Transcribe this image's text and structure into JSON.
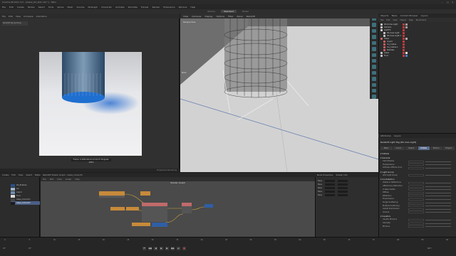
{
  "window": {
    "title": "Cinema 4D R21.117 - [Glass_Tut_R21.c4d *] - Main"
  },
  "menubar": [
    "File",
    "Edit",
    "Create",
    "Modes",
    "Select",
    "Tools",
    "Spline",
    "Mesh",
    "Volume",
    "MoGraph",
    "Character",
    "Animate",
    "Simulate",
    "Tracker",
    "Render",
    "Extensions",
    "Window",
    "Help"
  ],
  "layout_tabs": [
    {
      "label": "Startup",
      "active": false
    },
    {
      "label": "Standard",
      "active": true
    },
    {
      "label": "Model",
      "active": false
    }
  ],
  "render_viewer": {
    "menu": [
      "File",
      "Edit",
      "View",
      "Compare",
      "Animation"
    ],
    "side_label": "Redshift RenderView",
    "caption": "Frame: 0   2020-09-14 12:53:27 Progress: 100%",
    "status": "Progressive Rendering"
  },
  "viewport": {
    "menu": [
      "View",
      "Cameras",
      "Display",
      "Options",
      "Filter",
      "Panel",
      "Redshift"
    ],
    "label": "Perspective",
    "left_label": "Mesh"
  },
  "right_toolbar_count": 14,
  "objects": {
    "tabs": [
      "Objects",
      "Takes",
      "Content Browser",
      "Layers"
    ],
    "menu": [
      "File",
      "Edit",
      "View",
      "Object",
      "Tags",
      "Bookmarks"
    ],
    "rows": [
      {
        "name": "RS Dome Light",
        "color": "#c9c9c9",
        "indent": 0,
        "tags": [
          "#c03a3a",
          "#9a9a9a"
        ]
      },
      {
        "name": "Camera",
        "color": "#c9c9c9",
        "indent": 0,
        "tags": [
          "#c03a3a",
          "#9a9a9a"
        ]
      },
      {
        "name": "LIGHTS",
        "color": "#d0d0d0",
        "indent": 0,
        "tags": [
          "#c03a3a"
        ]
      },
      {
        "name": "RS Area Light",
        "color": "#c9c9c9",
        "indent": 1,
        "tags": [
          "#c03a3a"
        ]
      },
      {
        "name": "RS Area Light.1",
        "color": "#c9c9c9",
        "indent": 1,
        "tags": [
          "#c03a3a"
        ]
      },
      {
        "name": "Glass",
        "color": "#d06060",
        "indent": 0,
        "tags": [
          "#c03a3a",
          "#aaaaaa"
        ]
      },
      {
        "name": "Liquid",
        "color": "#d06060",
        "indent": 1,
        "tags": [
          "#c03a3a"
        ]
      },
      {
        "name": "Ice_Cubes",
        "color": "#d06060",
        "indent": 1,
        "tags": [
          "#c03a3a"
        ]
      },
      {
        "name": "Ice_Cubes.1",
        "color": "#d06060",
        "indent": 1,
        "tags": [
          "#c03a3a"
        ]
      },
      {
        "name": "Bubbles",
        "color": "#d06060",
        "indent": 1,
        "tags": [
          "#c03a3a"
        ]
      },
      {
        "name": "Glass",
        "color": "#c9c9c9",
        "indent": 0,
        "tags": [
          "#c03a3a",
          "#dddddd"
        ]
      },
      {
        "name": "Floor",
        "color": "#c9c9c9",
        "indent": 0,
        "tags": [
          "#c03a3a",
          "#3f7fd0"
        ]
      }
    ]
  },
  "attributes": {
    "tabs": [
      "Attributes",
      "Layers"
    ],
    "header": "Redshift Light Tag [RS Area Light]",
    "subtabs": [
      {
        "label": "Basic",
        "on": false
      },
      {
        "label": "Coord.",
        "on": false
      },
      {
        "label": "Object",
        "on": false
      },
      {
        "label": "Details",
        "on": true
      },
      {
        "label": "Photon",
        "on": false
      },
      {
        "label": "Project",
        "on": false
      }
    ],
    "sections": [
      {
        "title": "Details",
        "params": []
      },
      {
        "title": "General",
        "params": [
          "Cast Shadow",
          "Transparency",
          "Softness Affects Color"
        ]
      },
      {
        "title": "Light Group",
        "params": [
          "AOV Light Group"
        ]
      },
      {
        "title": "Contribution",
        "params": [
          "Visible in Reflections",
          "Affected by Refraction",
          "In Pass Visible",
          "Diffuse",
          "Reflection",
          "Transmission",
          "Single Scattering",
          "Multiple Scattering",
          "Global Illumination",
          "Volume"
        ]
      },
      {
        "title": "Caustics",
        "params": [
          "Caustic Photons",
          "Intensity",
          "Photons"
        ]
      }
    ]
  },
  "material_panel": {
    "tabs": [
      "Create",
      "Edit",
      "View",
      "Select",
      "Material",
      "Texture"
    ],
    "materials": [
      {
        "name": "RS_Bubbles",
        "color": "#2b4f86",
        "selected": false
      },
      {
        "name": "Ice",
        "color": "#9fb3c8",
        "selected": false
      },
      {
        "name": "Liquid",
        "color": "#6c8fb0",
        "selected": false
      },
      {
        "name": "Floor",
        "color": "#d9d9d9",
        "selected": false
      },
      {
        "name": "Glass_Colourful",
        "color": "#444444",
        "selected": false
      },
      {
        "name": "Glass_Colourful",
        "color": "#1b1b1b",
        "selected": true
      }
    ]
  },
  "node_editor": {
    "tabs": [
      "Redshift Shader Graph - Glass_Colourful"
    ],
    "menu": [
      "File",
      "Edit",
      "View",
      "Graph",
      "Help"
    ],
    "title": "Shader Graph",
    "side_tabs": [
      "Node Properties",
      "Shader Info"
    ],
    "side_rows": [
      "Base",
      "Base",
      "Base",
      "Base",
      "Base"
    ]
  },
  "timeline": {
    "ticks": [
      "0",
      "5",
      "10",
      "15",
      "20",
      "25",
      "30",
      "35",
      "40",
      "45",
      "50",
      "55",
      "60",
      "65",
      "70",
      "75",
      "80",
      "85",
      "90"
    ],
    "start": "0 F",
    "end": "90 F",
    "current": "0 F"
  }
}
